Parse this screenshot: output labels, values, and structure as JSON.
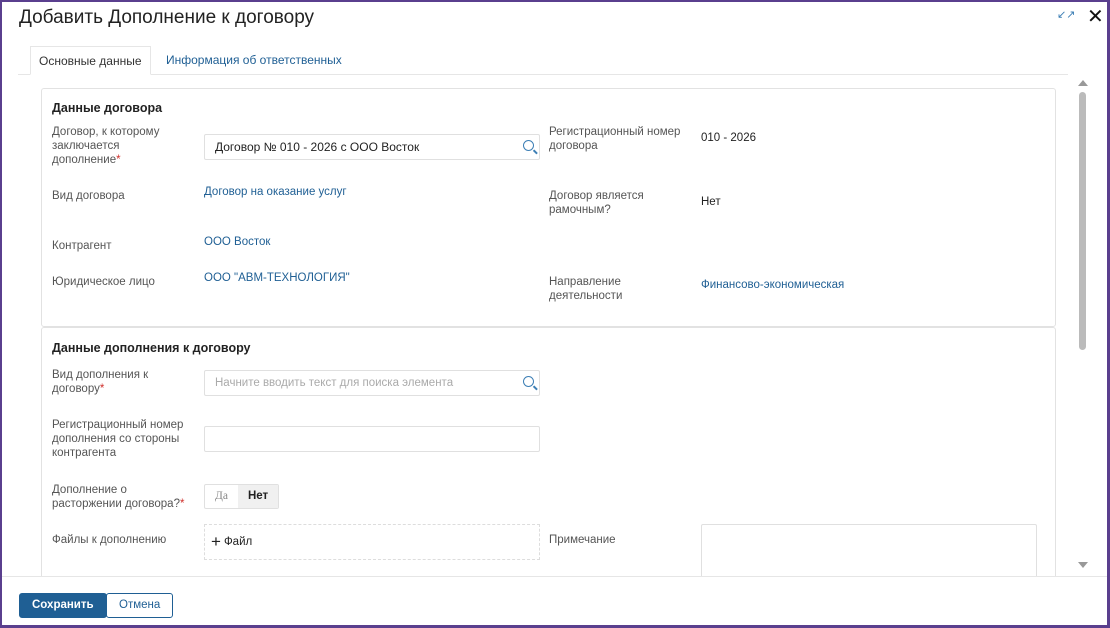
{
  "dialog": {
    "title": "Добавить Дополнение к договору",
    "expand_icon": "expand-icon",
    "close_icon": "close-icon"
  },
  "tabs": [
    {
      "label": "Основные данные",
      "active": true
    },
    {
      "label": "Информация об ответственных",
      "active": false
    }
  ],
  "contract": {
    "heading": "Данные договора",
    "contract_label": "Договор, к которому заключается дополнение",
    "contract_value": "Договор  № 010 - 2026  с ООО Восток",
    "regnum_label": "Регистрационный номер договора",
    "regnum_value": "010 - 2026",
    "type_label": "Вид договора",
    "type_value": "Договор на оказание услуг",
    "frame_label": "Договор является рамочным?",
    "frame_value": "Нет",
    "counterparty_label": "Контрагент",
    "counterparty_value": "ООО Восток",
    "legal_label": "Юридическое лицо",
    "legal_value": "ООО \"АВМ-ТЕХНОЛОГИЯ\"",
    "direction_label": "Направление деятельности",
    "direction_value": "Финансово-экономическая"
  },
  "addendum": {
    "heading": "Данные дополнения к договору",
    "kind_label": "Вид дополнения к договору",
    "kind_placeholder": "Начните вводить текст для поиска элемента",
    "cp_regnum_label": "Регистрационный номер дополнения со стороны контрагента",
    "cp_regnum_value": "",
    "termination_label": "Дополнение о расторжении договора?",
    "termination_yes": "Да",
    "termination_no": "Нет",
    "termination_selected": "Нет",
    "files_label": "Файлы к дополнению",
    "files_button": "Файл",
    "note_label": "Примечание",
    "note_value": ""
  },
  "footer": {
    "save": "Сохранить",
    "cancel": "Отмена"
  },
  "colors": {
    "accent": "#1f5f94",
    "frame": "#5a3f8e",
    "required": "#d0312d"
  }
}
